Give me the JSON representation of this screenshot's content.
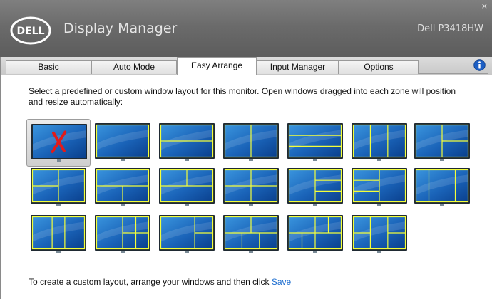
{
  "window": {
    "title": "Display Manager",
    "logo_text": "DELL",
    "monitor_model": "Dell P3418HW",
    "close_glyph": "×"
  },
  "tabs": [
    {
      "label": "Basic",
      "active": false
    },
    {
      "label": "Auto Mode",
      "active": false
    },
    {
      "label": "Easy Arrange",
      "active": true
    },
    {
      "label": "Input Manager",
      "active": false
    },
    {
      "label": "Options",
      "active": false
    }
  ],
  "info_icon": "info-icon",
  "description": "Select a predefined or custom window layout for this monitor.  Open windows dragged into each zone will position and resize automatically:",
  "layouts": [
    {
      "id": "off",
      "selected": true
    },
    {
      "id": "full",
      "selected": false
    },
    {
      "id": "halves-horizontal",
      "selected": false
    },
    {
      "id": "halves-vertical",
      "selected": false
    },
    {
      "id": "thirds-horizontal",
      "selected": false
    },
    {
      "id": "thirds-vertical",
      "selected": false
    },
    {
      "id": "left-half-right-split",
      "selected": false
    },
    {
      "id": "left-split-right-half",
      "selected": false
    },
    {
      "id": "top-half-bottom-split",
      "selected": false
    },
    {
      "id": "top-split-bottom-half",
      "selected": false
    },
    {
      "id": "quarters",
      "selected": false
    },
    {
      "id": "left-half-right-thirds",
      "selected": false
    },
    {
      "id": "left-thirds-right-half",
      "selected": false
    },
    {
      "id": "center-wide-sides-narrow",
      "selected": false
    },
    {
      "id": "center-narrow-sides-wide",
      "selected": false
    },
    {
      "id": "left-half-right-grid",
      "selected": false
    },
    {
      "id": "left-wide-right-split",
      "selected": false
    },
    {
      "id": "top-split-bottom-three",
      "selected": false
    },
    {
      "id": "grid-complex",
      "selected": false
    },
    {
      "id": "three-cols-split",
      "selected": false
    },
    {
      "id": "six-grid",
      "selected": false
    }
  ],
  "footer": {
    "text": "To create a custom layout, arrange your windows and then click",
    "save_label": "Save"
  },
  "colors": {
    "zone_border": "#f4ff3a",
    "screen_blue_dark": "#0a3f8c",
    "screen_blue_light": "#3a95de",
    "bezel": "#1f2a33",
    "link": "#1f6fd0",
    "off_mark": "#e01b1b"
  }
}
